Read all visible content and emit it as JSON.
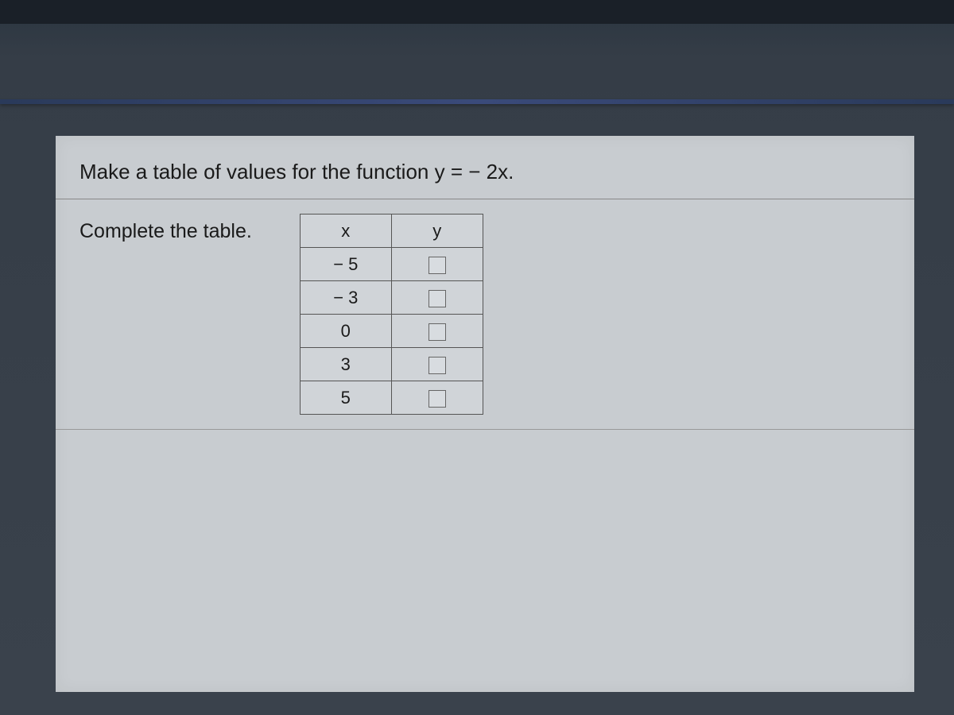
{
  "question": "Make a table of values for the function y = − 2x.",
  "instruction": "Complete the table.",
  "table": {
    "headers": {
      "x": "x",
      "y": "y"
    },
    "rows": [
      {
        "x": "− 5",
        "y": ""
      },
      {
        "x": "− 3",
        "y": ""
      },
      {
        "x": "0",
        "y": ""
      },
      {
        "x": "3",
        "y": ""
      },
      {
        "x": "5",
        "y": ""
      }
    ]
  }
}
